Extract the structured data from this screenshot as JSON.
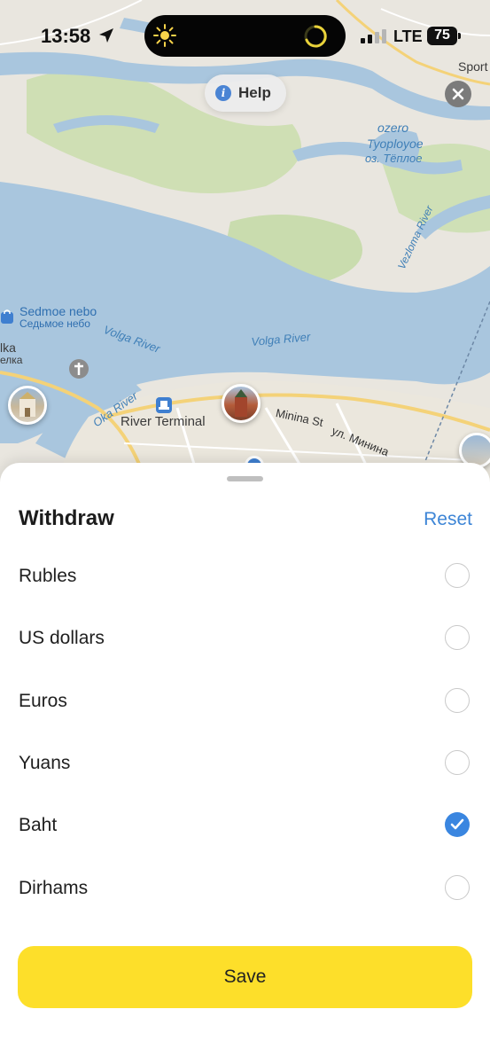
{
  "status_bar": {
    "time": "13:58",
    "network": "LTE",
    "battery": "75"
  },
  "map": {
    "help_label": "Help",
    "labels": {
      "sport": "Sport",
      "ozero_1": "ozero",
      "ozero_2": "Tyoployoe",
      "ozero_ru": "оз. Тёплое",
      "vezloma": "Vezloma River",
      "sedmoe_en": "Sedmoe nebo",
      "sedmoe_ru": "Седьмое небо",
      "volga_1": "Volga River",
      "volga_2": "Volga River",
      "oka": "Oka River",
      "lka": "lka",
      "elka": "елка",
      "river_terminal": "River Terminal",
      "minina_en": "Minina St",
      "minina_ru": "ул. Минина"
    }
  },
  "sheet": {
    "title": "Withdraw",
    "reset_label": "Reset",
    "options": [
      {
        "label": "Rubles",
        "selected": false
      },
      {
        "label": "US dollars",
        "selected": false
      },
      {
        "label": "Euros",
        "selected": false
      },
      {
        "label": "Yuans",
        "selected": false
      },
      {
        "label": "Baht",
        "selected": true
      },
      {
        "label": "Dirhams",
        "selected": false
      }
    ],
    "save_label": "Save"
  },
  "colors": {
    "accent_blue": "#3a86e0",
    "save_yellow": "#fddf2a",
    "water": "#a9c6de",
    "land": "#e9e6df",
    "park": "#c9dcae"
  }
}
